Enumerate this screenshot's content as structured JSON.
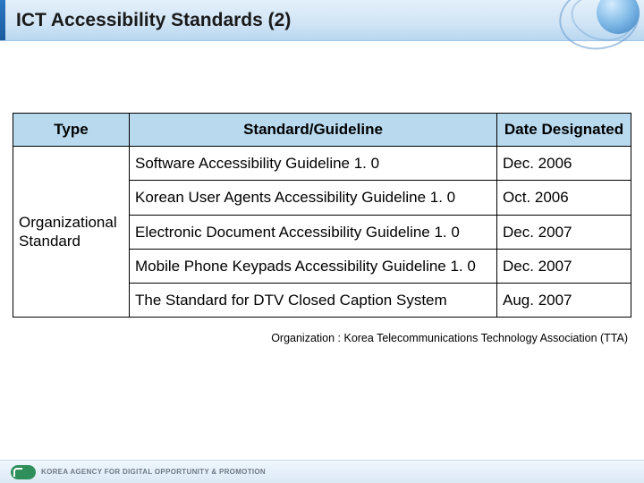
{
  "header": {
    "title": "ICT Accessibility Standards (2)"
  },
  "table": {
    "headers": {
      "type": "Type",
      "standard": "Standard/Guideline",
      "date": "Date Designated"
    },
    "type_label": "Organizational Standard",
    "rows": [
      {
        "standard": "Software Accessibility Guideline 1. 0",
        "date": "Dec. 2006"
      },
      {
        "standard": "Korean User Agents Accessibility Guideline 1. 0",
        "date": "Oct. 2006"
      },
      {
        "standard": "Electronic Document Accessibility Guideline 1. 0",
        "date": "Dec. 2007"
      },
      {
        "standard": "Mobile Phone Keypads Accessibility Guideline 1. 0",
        "date": "Dec. 2007"
      },
      {
        "standard": "The Standard for DTV Closed Caption System",
        "date": "Aug. 2007"
      }
    ]
  },
  "footnote": "Organization :  Korea Telecommunications Technology Association (TTA)",
  "footer": {
    "org": "KOREA AGENCY FOR DIGITAL OPPORTUNITY & PROMOTION"
  }
}
